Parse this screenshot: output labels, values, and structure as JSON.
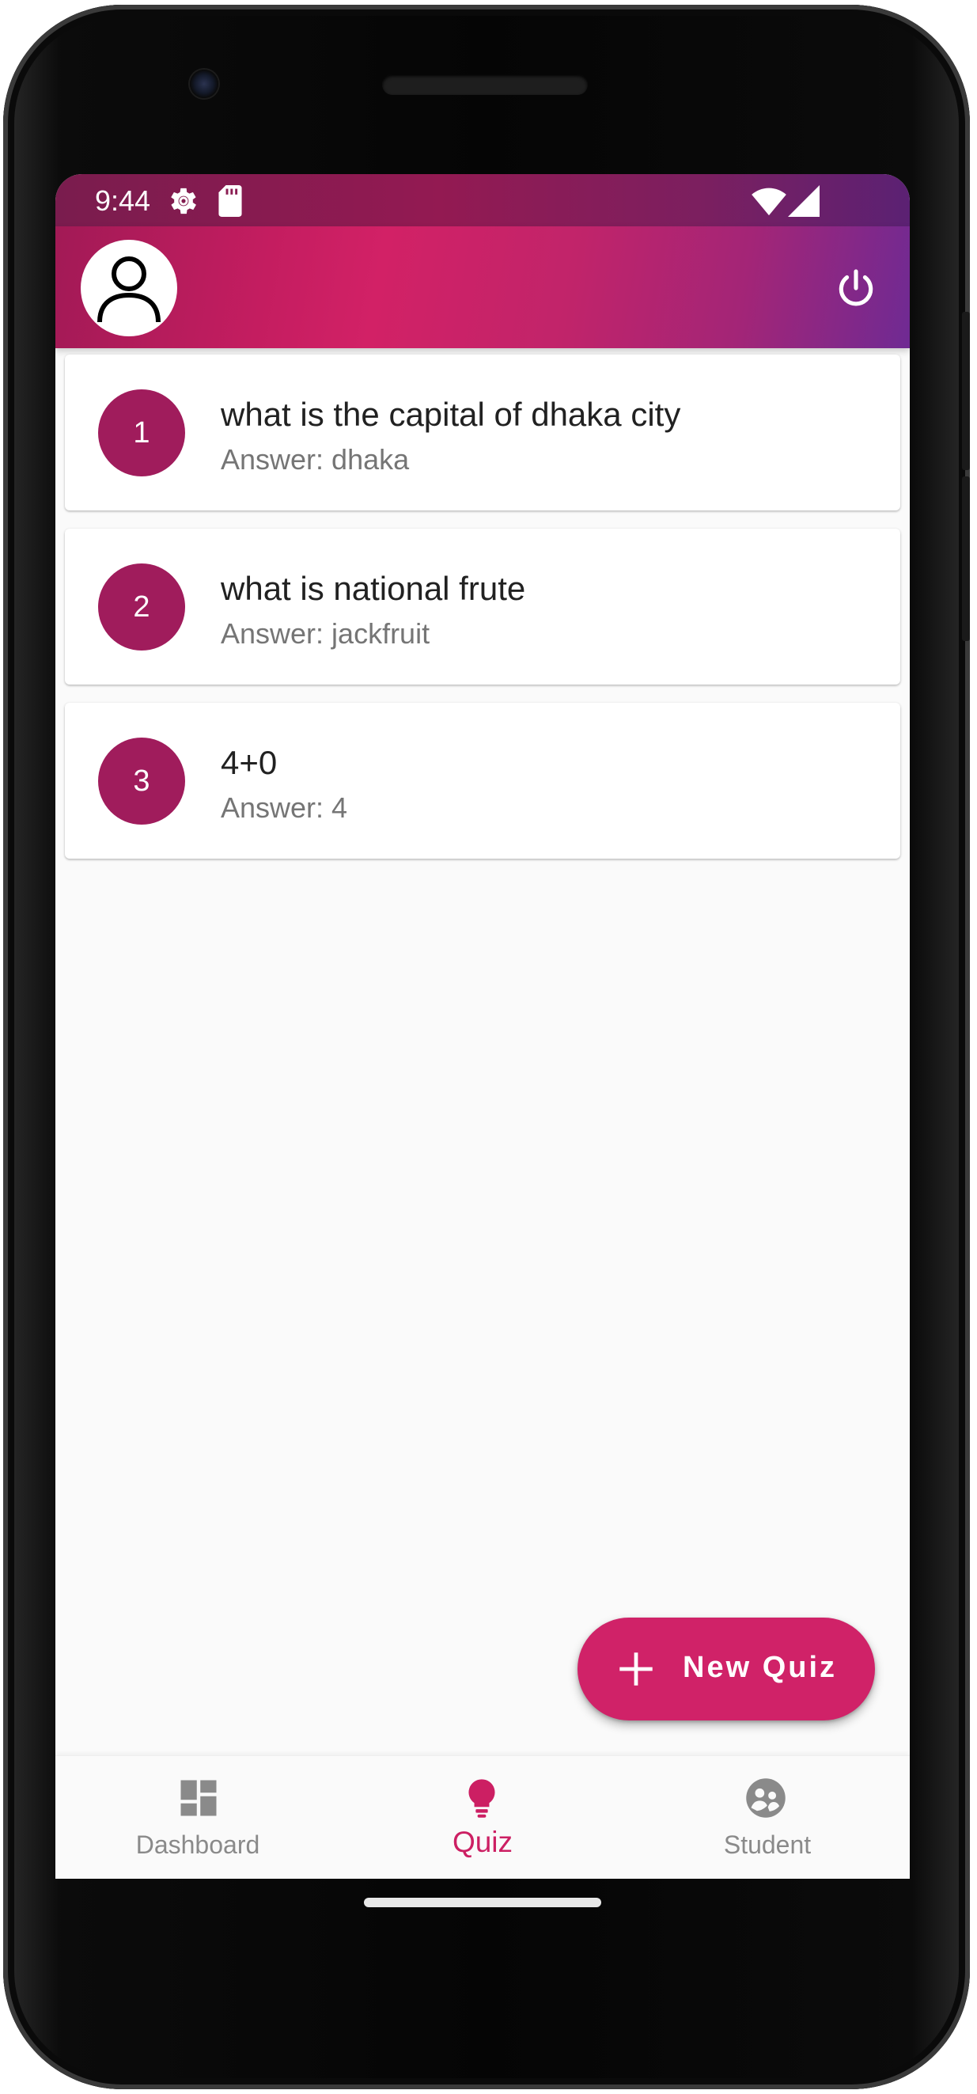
{
  "status_bar": {
    "time": "9:44",
    "icons": [
      "settings-gear-icon",
      "sd-card-icon",
      "wifi-icon",
      "cell-signal-icon"
    ]
  },
  "app_bar": {
    "avatar_icon": "person-icon",
    "action_icon": "power-icon"
  },
  "quizzes": [
    {
      "number": "1",
      "question": "what is the capital of dhaka city",
      "answer": "Answer: dhaka"
    },
    {
      "number": "2",
      "question": "what is national frute",
      "answer": "Answer: jackfruit"
    },
    {
      "number": "3",
      "question": "4+0",
      "answer": "Answer: 4"
    }
  ],
  "fab": {
    "icon": "plus-icon",
    "label": "New Quiz"
  },
  "bottom_nav": {
    "items": [
      {
        "label": "Dashboard",
        "icon": "dashboard-icon",
        "active": false
      },
      {
        "label": "Quiz",
        "icon": "lightbulb-icon",
        "active": true
      },
      {
        "label": "Student",
        "icon": "student-group-icon",
        "active": false
      }
    ]
  },
  "colors": {
    "primary": "#c41d60",
    "primary_dark": "#7a1c4e",
    "accent": "#d02268",
    "circle_badge": "#a01c5c",
    "gradient_end": "#6f2a93",
    "nav_active": "#cc1f63",
    "nav_inactive": "#8a8a8a"
  }
}
